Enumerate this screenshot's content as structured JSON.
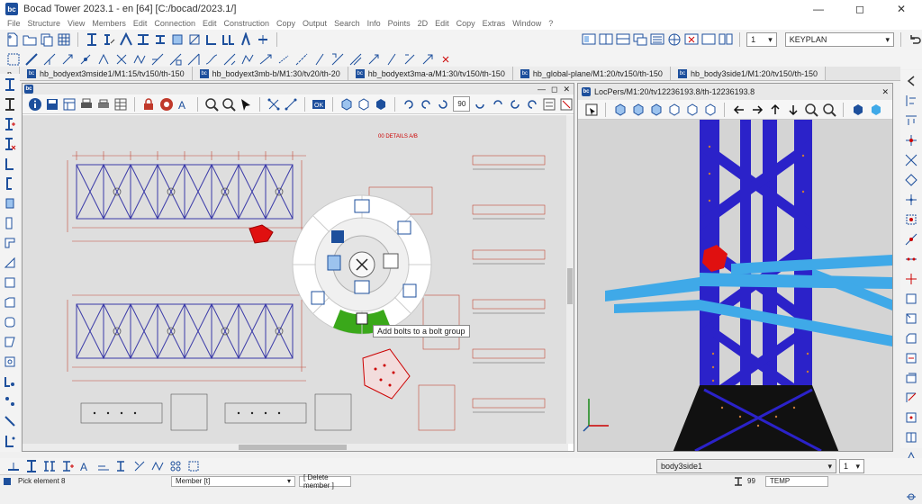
{
  "window": {
    "title": "Bocad Tower 2023.1 - en [64]  [C:/bocad/2023.1/]",
    "app_icon": "bocad-app-icon"
  },
  "menu": [
    "File",
    "Structure",
    "View",
    "Members",
    "Edit",
    "Connection",
    "Edit",
    "Construction",
    "Copy",
    "Output",
    "Search",
    "Info",
    "Points",
    "2D",
    "Edit",
    "Copy",
    "Extras",
    "Window",
    "?"
  ],
  "toolbar_right": {
    "scale_value": "1",
    "view_select": "KEYPLAN"
  },
  "tabs": [
    {
      "label": "n"
    },
    {
      "label": "hb_bodyext3mside1/M1:15/tv150/th-150"
    },
    {
      "label": "hb_bodyext3mb-b/M1:30/tv20/th-20"
    },
    {
      "label": "hb_bodyext3ma-a/M1:30/tv150/th-150"
    },
    {
      "label": "hb_global-plane/M1:20/tv150/th-150"
    },
    {
      "label": "hb_body3side1/M1:20/tv150/th-150"
    }
  ],
  "drawing_window": {
    "zoom_value": "90",
    "header_note": "00 DETAILS A/B"
  },
  "model_window": {
    "title": "LocPers/M1:20/tv12236193.8/th-12236193.8"
  },
  "radial_menu": {
    "tooltip": "Add bolts to a bolt group"
  },
  "status": {
    "prompt": "Pick element 8",
    "mode": "Member [t]",
    "command": "[ Delete member ]",
    "view_name": "body3side1",
    "view_num": "1",
    "count": "99",
    "layer": "TEMP"
  },
  "colors": {
    "steel_blue": "#2b22c9",
    "light_blue": "#3fa9e8",
    "black_steel": "#111111",
    "highlight_red": "#e01010",
    "accent_green": "#3aa81a",
    "toolbar_blue": "#1d4f9c"
  }
}
